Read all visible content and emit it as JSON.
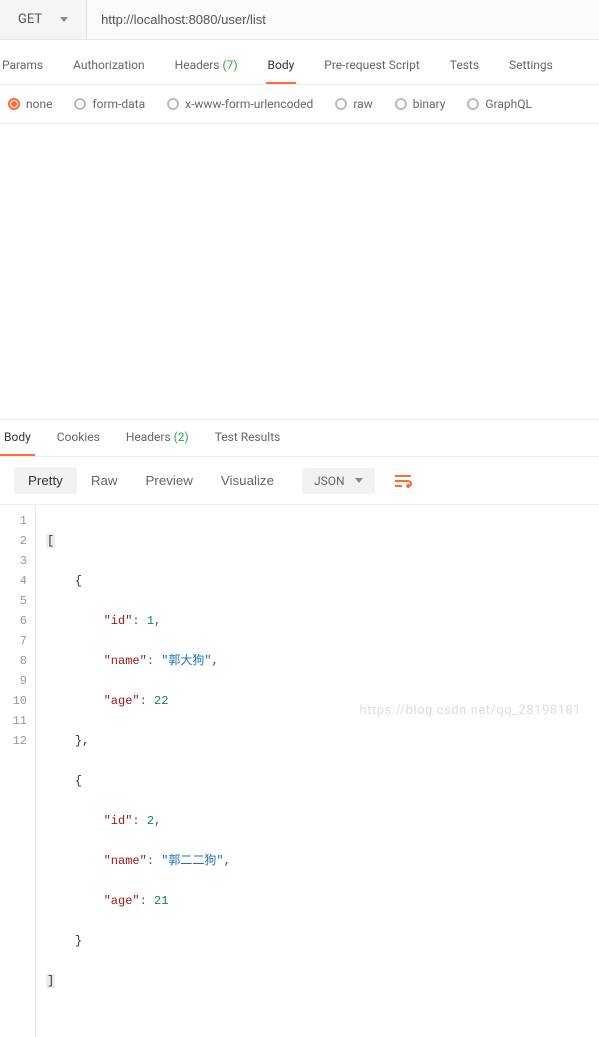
{
  "request": {
    "method": "GET",
    "url": "http://localhost:8080/user/list"
  },
  "requestTabs": {
    "params": "Params",
    "authorization": "Authorization",
    "headers": "Headers",
    "headersCount": "(7)",
    "body": "Body",
    "prerequest": "Pre-request Script",
    "tests": "Tests",
    "settings": "Settings"
  },
  "bodyTypes": {
    "none": "none",
    "formdata": "form-data",
    "xwww": "x-www-form-urlencoded",
    "raw": "raw",
    "binary": "binary",
    "graphql": "GraphQL"
  },
  "responseTabs": {
    "body": "Body",
    "cookies": "Cookies",
    "headers": "Headers",
    "headersCount": "(2)",
    "testResults": "Test Results"
  },
  "viewControls": {
    "pretty": "Pretty",
    "raw": "Raw",
    "preview": "Preview",
    "visualize": "Visualize",
    "format": "JSON"
  },
  "lineNumbers": [
    "1",
    "2",
    "3",
    "4",
    "5",
    "6",
    "7",
    "8",
    "9",
    "10",
    "11",
    "12"
  ],
  "responseBody": [
    {
      "id": 1,
      "name": "郭大狗",
      "age": 22
    },
    {
      "id": 2,
      "name": "郭二二狗",
      "age": 21
    }
  ],
  "code": {
    "open": "[",
    "brace_open": "{",
    "brace_close_comma": "},",
    "brace_close": "}",
    "close": "]",
    "k_id": "\"id\"",
    "k_name": "\"name\"",
    "k_age": "\"age\"",
    "v_id1": "1",
    "v_name1": "\"郭大狗\"",
    "v_age1": "22",
    "v_id2": "2",
    "v_name2": "\"郭二二狗\"",
    "v_age2": "21",
    "colon": ": ",
    "comma": ","
  },
  "watermark": "https://blog.csdn.net/qq_28198181"
}
